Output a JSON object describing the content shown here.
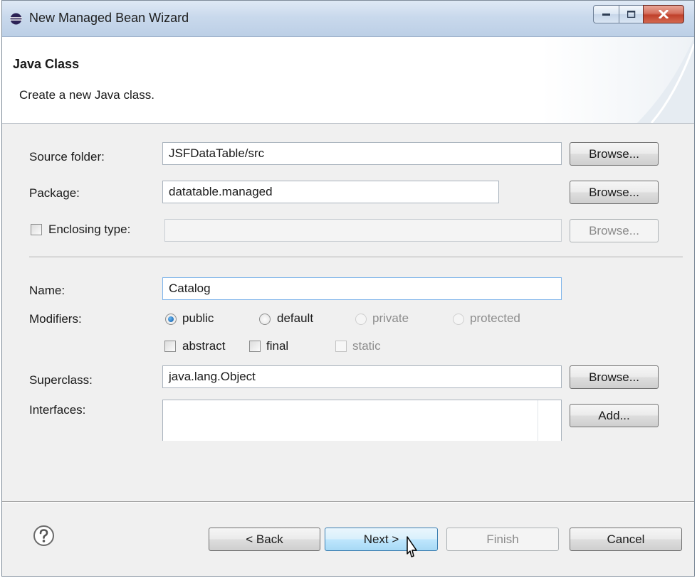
{
  "window": {
    "title": "New Managed Bean Wizard",
    "controls": {
      "minimize": "minimize-icon",
      "maximize": "maximize-icon",
      "close": "close-icon"
    }
  },
  "header": {
    "title": "Java Class",
    "description": "Create a new Java class."
  },
  "form": {
    "source_folder": {
      "label": "Source folder:",
      "value": "JSFDataTable/src",
      "browse": "Browse..."
    },
    "package": {
      "label": "Package:",
      "value": "datatable.managed",
      "browse": "Browse..."
    },
    "enclosing_type": {
      "label": "Enclosing type:",
      "value": "",
      "browse": "Browse...",
      "checked": false,
      "enabled": false
    },
    "name": {
      "label": "Name:",
      "value": "Catalog"
    },
    "modifiers": {
      "label": "Modifiers:",
      "access": [
        {
          "label": "public",
          "selected": true,
          "enabled": true
        },
        {
          "label": "default",
          "selected": false,
          "enabled": true
        },
        {
          "label": "private",
          "selected": false,
          "enabled": false
        },
        {
          "label": "protected",
          "selected": false,
          "enabled": false
        }
      ],
      "flags": [
        {
          "label": "abstract",
          "checked": false,
          "enabled": true
        },
        {
          "label": "final",
          "checked": false,
          "enabled": true
        },
        {
          "label": "static",
          "checked": false,
          "enabled": false
        }
      ]
    },
    "superclass": {
      "label": "Superclass:",
      "value": "java.lang.Object",
      "browse": "Browse..."
    },
    "interfaces": {
      "label": "Interfaces:",
      "add": "Add..."
    }
  },
  "footer": {
    "help_icon": "help-icon",
    "back": "< Back",
    "next": "Next >",
    "finish": "Finish",
    "cancel": "Cancel"
  },
  "colors": {
    "titlebar": "#c9d9ec",
    "dialog_bg": "#f0f0f0",
    "close_button": "#c0412c",
    "selection": "#0e5aa7"
  }
}
